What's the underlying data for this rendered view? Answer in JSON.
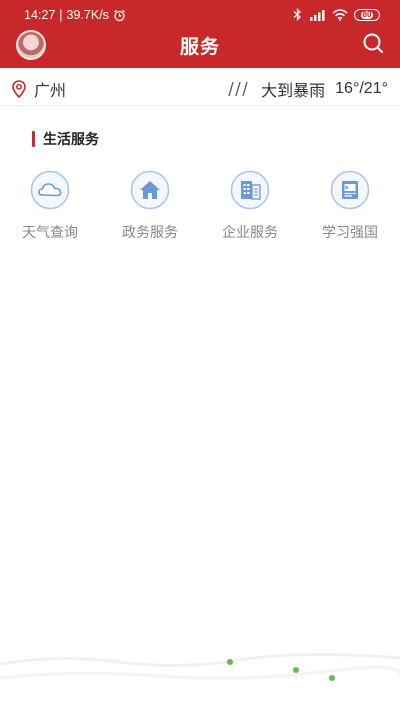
{
  "status_bar": {
    "time": "14:27",
    "speed": "39.7K/s",
    "battery": "80",
    "left_icons": [
      "alarm-icon"
    ],
    "right_icons": [
      "bluetooth-icon",
      "signal-icon",
      "wifi-icon",
      "battery-icon"
    ]
  },
  "header": {
    "title": "服务",
    "background": "#c8282a"
  },
  "info_row": {
    "location": "广州",
    "weather_icon": "rain-icon",
    "weather": "大到暴雨",
    "temperature": "16°/21°"
  },
  "section": {
    "title": "生活服务",
    "accent": "#c8282a"
  },
  "services": [
    {
      "label": "天气查询",
      "icon": "cloud-icon"
    },
    {
      "label": "政务服务",
      "icon": "house-icon"
    },
    {
      "label": "企业服务",
      "icon": "building-icon"
    },
    {
      "label": "学习强国",
      "icon": "flag-icon"
    }
  ],
  "colors": {
    "icon_circle": "#a9c4e6",
    "icon_fill": "#6b9bd6",
    "label": "#888888"
  }
}
